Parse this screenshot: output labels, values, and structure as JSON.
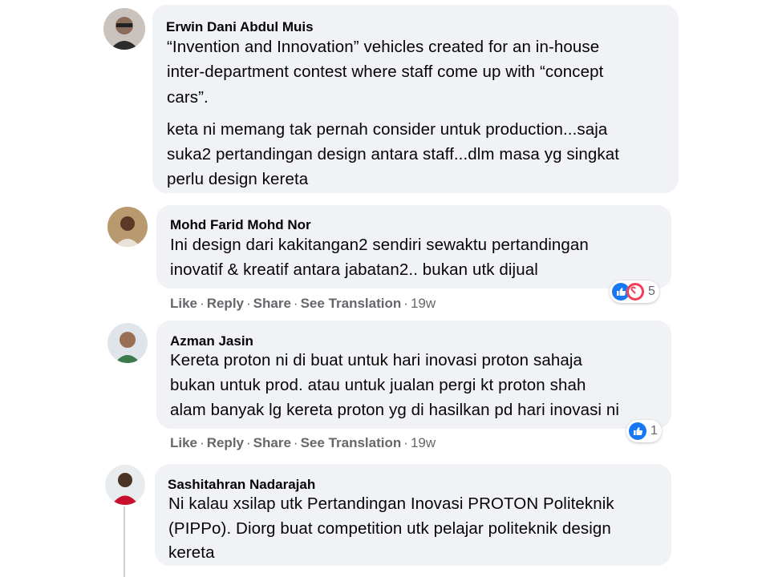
{
  "comments": [
    {
      "author": "Erwin Dani Abdul Muis",
      "lines": [
        "“Invention and Innovation” vehicles created for an in-house",
        "inter-department contest where staff come up with “concept",
        "cars”.",
        "keta ni memang tak pernah consider untuk production...saja",
        "suka2 pertandingan design antara staff...dlm masa yg singkat",
        "perlu design kereta"
      ]
    },
    {
      "author": "Mohd Farid Mohd Nor",
      "lines": [
        "Ini design dari kakitangan2 sendiri sewaktu pertandingan",
        "inovatif & kreatif antara jabatan2.. bukan utk dijual"
      ],
      "actions": {
        "like": "Like",
        "reply": "Reply",
        "share": "Share",
        "translate": "See Translation",
        "time": "19w"
      },
      "reaction_icons": [
        "like-icon",
        "care-icon"
      ],
      "reaction_count": "5"
    },
    {
      "author": "Azman Jasin",
      "lines": [
        "Kereta proton ni di buat untuk hari inovasi proton sahaja",
        "bukan untuk prod. atau untuk jualan pergi kt proton shah",
        "alam banyak lg kereta proton yg di hasilkan pd hari inovasi ni"
      ],
      "actions": {
        "like": "Like",
        "reply": "Reply",
        "share": "Share",
        "translate": "See Translation",
        "time": "19w"
      },
      "reaction_icons": [
        "like-icon"
      ],
      "reaction_count": "1"
    },
    {
      "author": "Sashitahran Nadarajah",
      "lines": [
        "Ni kalau xsilap utk Pertandingan Inovasi PROTON Politeknik",
        "(PIPPo). Diorg buat competition utk pelajar politeknik design",
        "kereta"
      ]
    }
  ],
  "colors": {
    "bubble": "#f0f2f5",
    "meta": "#65676b",
    "like_blue": "#1877f2",
    "care_red": "#f33e58"
  }
}
